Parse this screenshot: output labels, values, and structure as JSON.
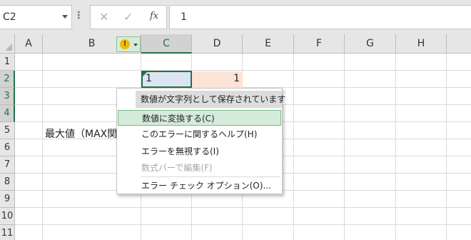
{
  "formula_bar": {
    "name_box": "C2",
    "separator": "⋮",
    "cancel_icon": "close-icon",
    "enter_icon": "check-icon",
    "fx_label": "fx",
    "formula_value": "1"
  },
  "sheet": {
    "columns": [
      "A",
      "B",
      "C",
      "D",
      "E",
      "F",
      "G",
      "H"
    ],
    "rows": [
      "1",
      "2",
      "3",
      "4",
      "5",
      "6",
      "7",
      "8",
      "9",
      "10",
      "11"
    ],
    "selected_column": "C",
    "selected_rows": [
      "2",
      "3",
      "4"
    ],
    "cells": {
      "C2": "1",
      "D2": "1",
      "B5": "最大値（MAX関"
    },
    "colors": {
      "accent": "#217346",
      "selected_fill": "#dce4f1",
      "d2_fill": "#fbe3d5"
    }
  },
  "error_button": {
    "icon": "warning-icon",
    "arrow": "chevron-down-icon",
    "glyph": "!"
  },
  "context_menu": {
    "header": "数値が文字列として保存されています",
    "items": [
      {
        "label": "数値に変換する(C)",
        "state": "highlighted"
      },
      {
        "label": "このエラーに関するヘルプ(H)",
        "state": "enabled"
      },
      {
        "label": "エラーを無視する(I)",
        "state": "enabled"
      },
      {
        "label": "数式バーで編集(F)",
        "state": "disabled"
      },
      {
        "label": "エラー チェック オプション(O)...",
        "state": "enabled"
      }
    ]
  }
}
